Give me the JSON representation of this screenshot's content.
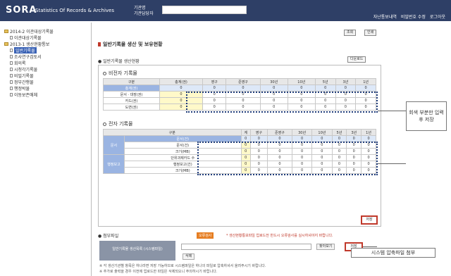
{
  "header": {
    "logo": "SORA",
    "subtitle": "Statistics Of Records & Archives",
    "label_org": "기관명",
    "label_user": "기관담당자",
    "links": [
      "자난통보내역",
      "비밀번호 수정",
      "로그아웃"
    ]
  },
  "sidebar": {
    "items": [
      {
        "label": "2014-2 이관대상기록물",
        "kind": "folder"
      },
      {
        "label": "이관대상기록물",
        "kind": "doc"
      },
      {
        "label": "2013-1 생산현황통보",
        "kind": "folder"
      },
      {
        "label": "일반기록물",
        "kind": "doc",
        "selected": true
      },
      {
        "label": "조사연구검토서",
        "kind": "doc"
      },
      {
        "label": "회의록",
        "kind": "doc"
      },
      {
        "label": "시청각기록물",
        "kind": "doc"
      },
      {
        "label": "비밀기록물",
        "kind": "doc"
      },
      {
        "label": "정부간행물",
        "kind": "doc"
      },
      {
        "label": "행정박물",
        "kind": "doc"
      },
      {
        "label": "이동보존매체",
        "kind": "doc"
      }
    ]
  },
  "main": {
    "btn_confirm": "조회",
    "btn_print": "인쇄",
    "title": "일반기록물 생산 및 보유현황",
    "subtitle": "● 일반기록물 생산현황",
    "download": "다운로드",
    "nonelec_title": "비전자 기록물",
    "nonelec_cols": [
      "구분",
      "총계(권)",
      "영구",
      "준영구",
      "30년",
      "10년",
      "5년",
      "3년",
      "1년"
    ],
    "nonelec_rows": [
      {
        "label": "총계(권)",
        "values": [
          "0",
          "0",
          "0",
          "0",
          "0",
          "0",
          "0",
          "0"
        ]
      },
      {
        "label": "문서 · 대장(권)",
        "values": [
          "0",
          "0",
          "0",
          "0",
          "0",
          "0",
          "0",
          "0"
        ]
      },
      {
        "label": "카드(권)",
        "values": [
          "0",
          "0",
          "0",
          "0",
          "0",
          "0",
          "0",
          "0"
        ]
      },
      {
        "label": "도면(권)",
        "values": [
          "0",
          "0",
          "0",
          "0",
          "0",
          "0",
          "0",
          "0"
        ]
      }
    ],
    "elec_title": "전자 기록물",
    "elec_cols": [
      "구분",
      "계",
      "영구",
      "준영구",
      "30년",
      "10년",
      "5년",
      "3년",
      "1년"
    ],
    "elec_groups": [
      {
        "group": "문서",
        "rows": [
          {
            "label": "문서(건)",
            "values": [
              "0",
              "0",
              "0",
              "0",
              "0",
              "0",
              "0",
              "0"
            ]
          },
          {
            "label": "문서(건)",
            "values": [
              "0",
              "0",
              "0",
              "0",
              "0",
              "0",
              "0",
              "0"
            ]
          },
          {
            "label": "크기(MB)",
            "values": [
              "0",
              "0",
              "0",
              "0",
              "0",
              "0",
              "0",
              "0"
            ]
          }
        ]
      },
      {
        "group": "행정보고",
        "rows": [
          {
            "label": "단위과제카드 수",
            "values": [
              "0",
              "0",
              "0",
              "0",
              "0",
              "0",
              "0",
              "0"
            ]
          },
          {
            "label": "행정보고(건)",
            "values": [
              "0",
              "0",
              "0",
              "0",
              "0",
              "0",
              "0",
              "0"
            ]
          },
          {
            "label": "크기(MB)",
            "values": [
              "0",
              "0",
              "0",
              "0",
              "0",
              "0",
              "0",
              "0"
            ]
          }
        ]
      }
    ],
    "save": "저장",
    "callout1": "회색 부분만 입력 후 저장",
    "attach_title": "● 첨부파일",
    "attach_badge": "오류검사",
    "attach_warning": "* 생산현황통보파일 업로드전 반드시 오류검사를 실시하셔야지 바랍니다.",
    "attach_label": "일반기록물 생산목록 (시스템파일)",
    "browse": "찾아보기",
    "attach_save": "저장",
    "delete": "삭제",
    "callout2": "시스템 압축파일 첨부",
    "notes": [
      "※ 각 생산기관별 항목은 하나라면 저장 가능하므로 시스템파일은 하나의 파일로 압축하셔서 올려주시기 바랍니다.",
      "※ 추가로 출력을 경우 이전에 업로드한 파일은 삭제되오니 주의하시기 바랍니다."
    ]
  }
}
